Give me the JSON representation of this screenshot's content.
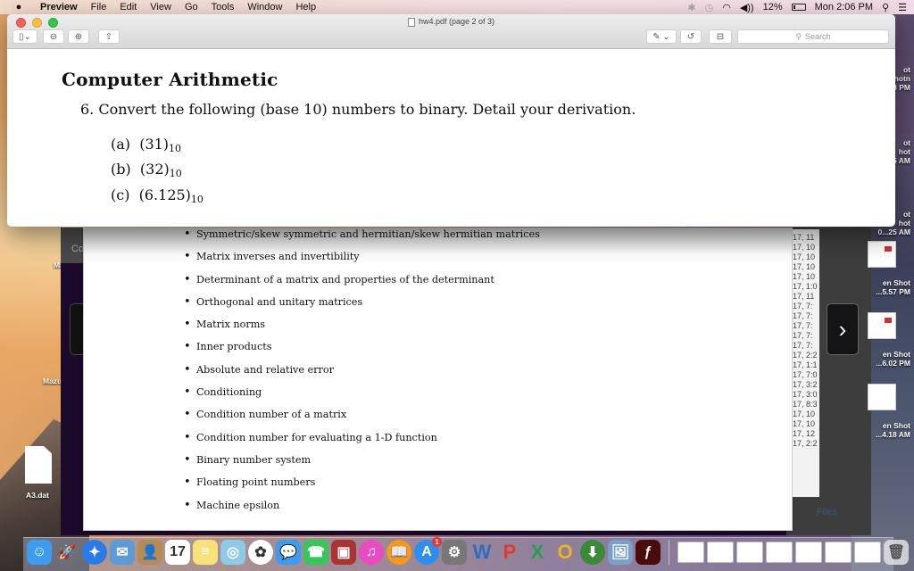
{
  "menubar": {
    "app": "Preview",
    "items": [
      "File",
      "Edit",
      "View",
      "Go",
      "Tools",
      "Window",
      "Help"
    ],
    "battery": "12%",
    "clock": "Mon 2:06 PM"
  },
  "window": {
    "title": "hw4.pdf (page 2 of 3)",
    "search_placeholder": "Search",
    "toolbar": {
      "sidebar": "sidebar-toggle",
      "zoom_out": "zoom-out",
      "zoom_in": "zoom-in",
      "share": "share",
      "markup": "markup",
      "rotate": "rotate",
      "toolbox": "toolbox"
    }
  },
  "page": {
    "heading": "Computer Arithmetic",
    "question": "6. Convert the following (base 10) numbers to binary. Detail your derivation.",
    "items": [
      {
        "label": "(a)",
        "value": "(31)",
        "base": "10"
      },
      {
        "label": "(b)",
        "value": "(32)",
        "base": "10"
      },
      {
        "label": "(c)",
        "value": "(6.125)",
        "base": "10"
      }
    ]
  },
  "background_doc": {
    "bullets": [
      "Symmetric/skew symmetric and hermitian/skew hermitian matrices",
      "Matrix inverses and invertibility",
      "Determinant of a matrix and properties of the determinant",
      "Orthogonal and unitary matrices",
      "Matrix norms",
      "Inner products",
      "Absolute and relative error",
      "Conditioning",
      "Condition number of a matrix",
      "Condition number for evaluating a 1-D function",
      "Binary number system",
      "Floating point numbers",
      "Machine epsilon"
    ],
    "timestamps": [
      "17, 11",
      "17, 10",
      "17, 10",
      "17, 10",
      "17, 10",
      "17, 1:0",
      "17, 11",
      "17, 7:",
      "17, 7:",
      "17, 7:",
      "17, 7:",
      "17, 7:",
      "17, 2:2",
      "17, 1:1",
      "17, 7:0",
      "17, 3:2",
      "17, 3:0",
      "17, 8:3",
      "17, 10",
      "17, 10",
      "17, 12",
      "17, 2:2"
    ],
    "files_label": "Files",
    "topbar_text": "Co",
    "next_glyph": "›"
  },
  "desktop": {
    "right_labels": [
      "ot\nhotn\n8 PM",
      "ot\nhot\n25 AM",
      "ot\nhot\n0...25 AM",
      "en Shot\n...5.57 PM",
      "en Shot\n...6.02 PM",
      "en Shot\n...4.18 AM"
    ],
    "left_labels": [
      "Ma",
      "Mazu",
      "A3.dat"
    ]
  },
  "dock": {
    "apps": [
      {
        "name": "finder",
        "color": "#3b9cf0",
        "glyph": "☺"
      },
      {
        "name": "launchpad",
        "color": "#6d6f77",
        "glyph": "🚀"
      },
      {
        "name": "safari",
        "color": "#2a7bea",
        "glyph": "✦"
      },
      {
        "name": "mail",
        "color": "#5e9bd6",
        "glyph": "✉"
      },
      {
        "name": "contacts",
        "color": "#b98a52",
        "glyph": "👤"
      },
      {
        "name": "calendar",
        "color": "#ffffff",
        "glyph": "17"
      },
      {
        "name": "notes",
        "color": "#f6e27a",
        "glyph": "≡"
      },
      {
        "name": "maps",
        "color": "#8fc9e8",
        "glyph": "◎"
      },
      {
        "name": "photos",
        "color": "#ffffff",
        "glyph": "✿"
      },
      {
        "name": "messages",
        "color": "#3b9cf0",
        "glyph": "💬"
      },
      {
        "name": "facetime",
        "color": "#35c759",
        "glyph": "☎"
      },
      {
        "name": "photo-booth",
        "color": "#a33",
        "glyph": "▣"
      },
      {
        "name": "itunes",
        "color": "#e84cc0",
        "glyph": "♫"
      },
      {
        "name": "ibooks",
        "color": "#f39a1c",
        "glyph": "📖"
      },
      {
        "name": "app-store",
        "color": "#2d8ef0",
        "glyph": "A",
        "badge": "1"
      },
      {
        "name": "system-preferences",
        "color": "#777",
        "glyph": "⚙"
      },
      {
        "name": "word",
        "color": "#2b6cc4",
        "glyph": "W"
      },
      {
        "name": "powerpoint",
        "color": "#e23a2a",
        "glyph": "P"
      },
      {
        "name": "excel",
        "color": "#22a04b",
        "glyph": "X"
      },
      {
        "name": "outlook",
        "color": "#f2b21d",
        "glyph": "O"
      },
      {
        "name": "downloader",
        "color": "#3a8a3a",
        "glyph": "⬇"
      },
      {
        "name": "preview",
        "color": "#7aa0c8",
        "glyph": "🖼"
      },
      {
        "name": "flash",
        "color": "#4a0b0b",
        "glyph": "ƒ"
      }
    ],
    "trash": "trash"
  }
}
